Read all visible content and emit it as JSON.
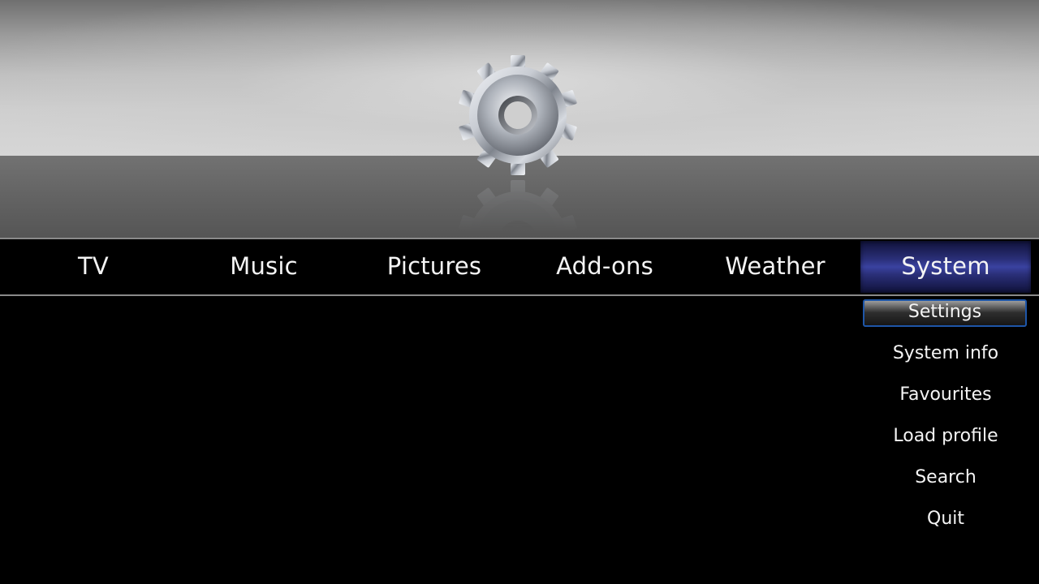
{
  "backdrop": {
    "icon": "gear-icon"
  },
  "main_menu": {
    "items": [
      {
        "label": "TV"
      },
      {
        "label": "Music"
      },
      {
        "label": "Pictures"
      },
      {
        "label": "Add-ons"
      },
      {
        "label": "Weather"
      },
      {
        "label": "System",
        "selected": true
      }
    ],
    "selected_color": "#2a2f78"
  },
  "submenu": {
    "items": [
      {
        "label": "Settings",
        "focused": true
      },
      {
        "label": "System info"
      },
      {
        "label": "Favourites"
      },
      {
        "label": "Load profile"
      },
      {
        "label": "Search"
      },
      {
        "label": "Quit"
      }
    ],
    "focus_border_color": "#1e56a8"
  }
}
